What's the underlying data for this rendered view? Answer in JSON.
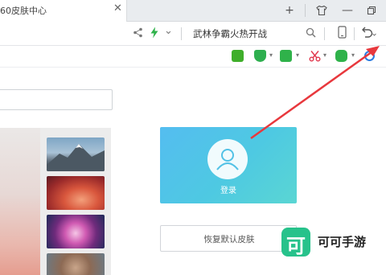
{
  "tab": {
    "title": "60皮肤中心",
    "close_glyph": "✕"
  },
  "window_controls": {
    "new_tab": "+",
    "skin_icon": "tshirt-icon",
    "minimize": "—",
    "restore": "restore-icon"
  },
  "toolbar": {
    "share_icon": "share-icon",
    "lightning_icon": "lightning-icon",
    "chevron": "⌄",
    "search_text": "武林争霸火热开战",
    "search_icon": "search-icon",
    "mobile_icon": "mobile-icon",
    "undo_icon": "undo-icon"
  },
  "extensions": [
    {
      "name": "ext-green-logo",
      "color": "#3fae2a"
    },
    {
      "name": "ext-shield",
      "color": "#2eaf4f"
    },
    {
      "name": "ext-translate",
      "color": "#2fb24a"
    },
    {
      "name": "ext-scissors",
      "color": "#e0364c"
    },
    {
      "name": "ext-game",
      "color": "#2fb24a"
    },
    {
      "name": "ext-blue",
      "color": "#2a7be0"
    }
  ],
  "content": {
    "login_label": "登录",
    "restore_label": "恢复默认皮肤"
  },
  "watermark": {
    "logo_char": "可",
    "text": "可可手游",
    "color": "#27c28b"
  },
  "annotation": {
    "arrow_color": "#e8383d"
  }
}
